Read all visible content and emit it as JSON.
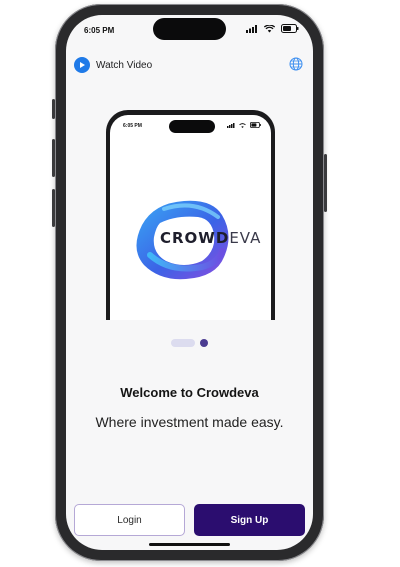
{
  "status_bar": {
    "time": "6:05 PM"
  },
  "header": {
    "watch_video_label": "Watch Video"
  },
  "mockup": {
    "status_time": "6:05 PM",
    "logo_text_part1": "CROWD",
    "logo_text_part2": "EVA"
  },
  "pagination": {
    "current_page": 2,
    "total_pages": 2
  },
  "content": {
    "welcome_title": "Welcome to Crowdeva",
    "tagline": "Where investment made easy."
  },
  "actions": {
    "login_label": "Login",
    "signup_label": "Sign Up"
  },
  "colors": {
    "accent": "#2b0d6f",
    "video_icon": "#1f7ae8",
    "dot_active": "#4b3c91"
  },
  "icons": [
    "play-icon",
    "globe-icon",
    "signal-icon",
    "wifi-icon",
    "battery-icon"
  ]
}
